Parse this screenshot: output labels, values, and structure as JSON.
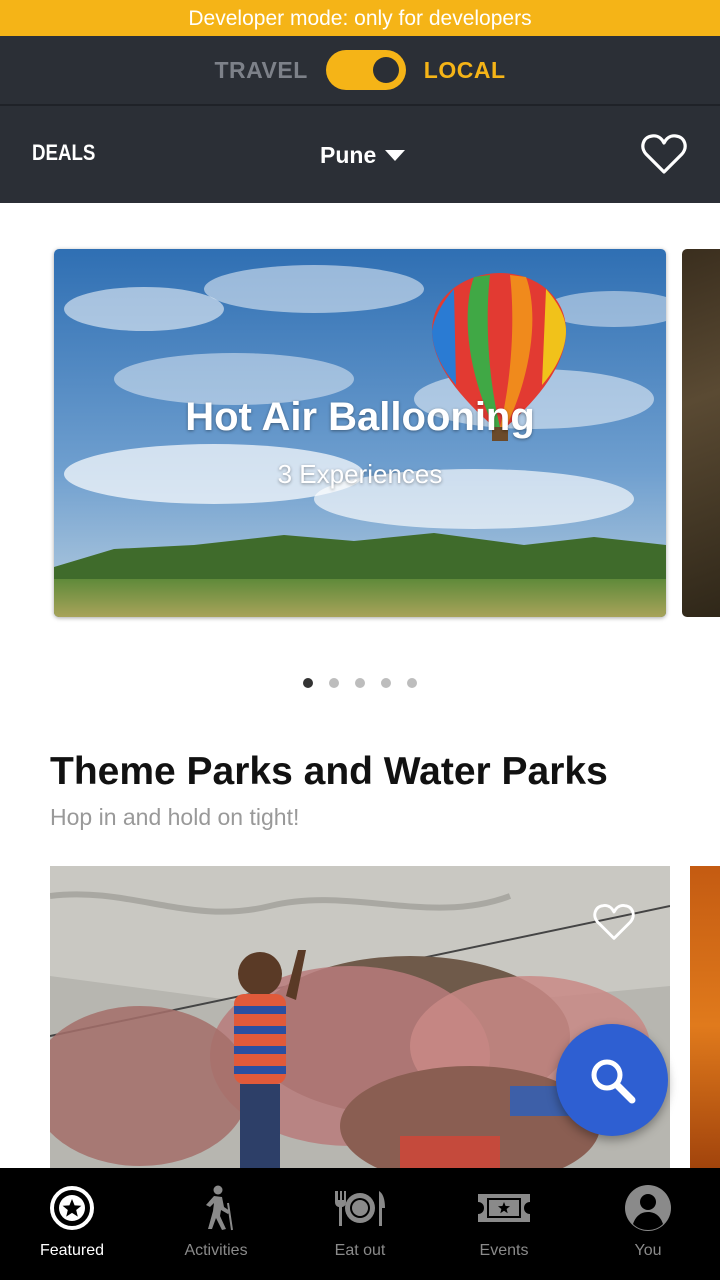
{
  "dev_banner": "Developer mode: only for developers",
  "mode_switch": {
    "left_label": "TRAVEL",
    "right_label": "LOCAL",
    "selected": "LOCAL"
  },
  "header": {
    "deals_label": "DEALS",
    "city": "Pune"
  },
  "hero": {
    "title": "Hot Air Ballooning",
    "subtitle": "3 Experiences",
    "page_count": 5,
    "active_index": 0
  },
  "section": {
    "title": "Theme Parks and Water Parks",
    "subtitle": "Hop in and hold on tight!"
  },
  "tabs": [
    {
      "label": "Featured",
      "icon": "featured-star-icon",
      "active": true
    },
    {
      "label": "Activities",
      "icon": "hiker-icon",
      "active": false
    },
    {
      "label": "Eat out",
      "icon": "fork-plate-knife-icon",
      "active": false
    },
    {
      "label": "Events",
      "icon": "ticket-icon",
      "active": false
    },
    {
      "label": "You",
      "icon": "user-avatar-icon",
      "active": false
    }
  ],
  "colors": {
    "accent": "#f5b417",
    "header_bg": "#2b2f36",
    "fab": "#2e5fd2",
    "tabbar_bg": "#000000"
  }
}
